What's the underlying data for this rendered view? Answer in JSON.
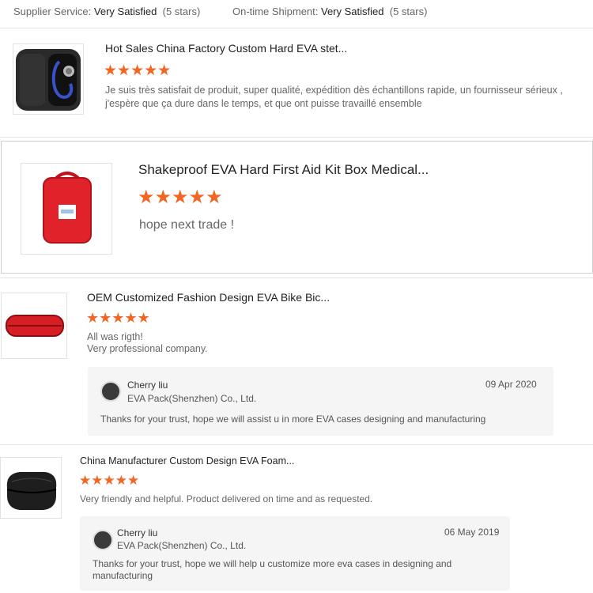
{
  "summary": {
    "supplier_service_label": "Supplier Service:",
    "supplier_service_value": "Very Satisfied",
    "supplier_service_stars": "(5 stars)",
    "ontime_label": "On-time Shipment:",
    "ontime_value": "Very Satisfied",
    "ontime_stars": "(5 stars)"
  },
  "colors": {
    "star": "#f26522",
    "reply_bg": "#f5f5f5",
    "divider": "#e3e3e3"
  },
  "reviews": [
    {
      "title": "Hot Sales China Factory Custom Hard EVA stet...",
      "rating": 5,
      "stars": "★★★★★",
      "text": "Je suis très satisfait de produit, super qualité, expédition dès échantillons rapide, un fournisseur sérieux , j'espère que ça dure dans le temps, et que ont puisse travaillé ensemble",
      "image": "stethoscope-case-image"
    },
    {
      "title": "Shakeproof EVA Hard First Aid Kit Box Medical...",
      "rating": 5,
      "stars": "★★★★★",
      "text": "hope next trade !",
      "image": "red-first-aid-case-image"
    },
    {
      "title": "OEM Customized Fashion Design EVA Bike Bic...",
      "rating": 5,
      "stars": "★★★★★",
      "text_lines": [
        "All was rigth!",
        "Very professional company."
      ],
      "image": "red-bike-case-image",
      "reply": {
        "name": "Cherry liu",
        "company": "EVA Pack(Shenzhen) Co., Ltd.",
        "date": "09 Apr 2020",
        "message": "Thanks for your trust, hope we will assist u in more EVA cases designing and manufacturing"
      }
    },
    {
      "title": "China Manufacturer Custom Design EVA Foam...",
      "rating": 5,
      "stars": "★★★★★",
      "text": "Very friendly and helpful. Product delivered on time and as requested.",
      "image": "black-foam-case-image",
      "reply": {
        "name": "Cherry liu",
        "company": "EVA Pack(Shenzhen) Co., Ltd.",
        "date": "06 May 2019",
        "message": "Thanks for your trust, hope we will help u customize more eva cases in designing and manufacturing"
      }
    }
  ]
}
